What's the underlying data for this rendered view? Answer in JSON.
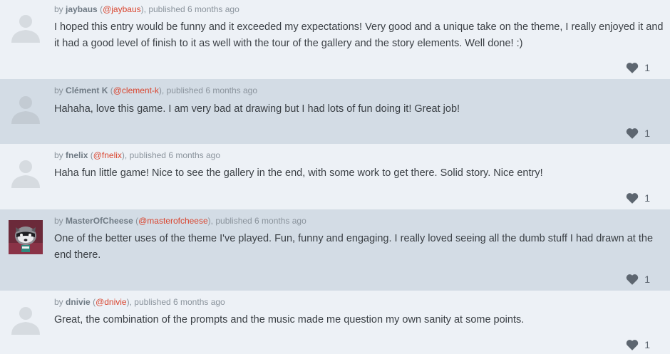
{
  "comments": [
    {
      "author": "jaybaus",
      "handle": "@jaybaus",
      "published": "published 6 months ago",
      "text": "I hoped this entry would be funny and it exceeded my expectations! Very good and a unique take on the theme, I really enjoyed it and it had a good level of finish to it as well with the tour of the gallery and the story elements. Well done! :)",
      "likes": "1",
      "avatar": "default-avatar"
    },
    {
      "author": "Clément K",
      "handle": "@clement-k",
      "published": "published 6 months ago",
      "text": "Hahaha, love this game. I am very bad at drawing but I had lots of fun doing it! Great job!",
      "likes": "1",
      "avatar": "default-avatar"
    },
    {
      "author": "fnelix",
      "handle": "@fnelix",
      "published": "published 6 months ago",
      "text": "Haha fun little game! Nice to see the gallery in the end, with some work to get there. Solid story. Nice entry!",
      "likes": "1",
      "avatar": "default-avatar"
    },
    {
      "author": "MasterOfCheese",
      "handle": "@masterofcheese",
      "published": "published 6 months ago",
      "text": "One of the better uses of the theme I've played. Fun, funny and engaging. I really loved seeing all the dumb stuff I had drawn at the end there.",
      "likes": "1",
      "avatar": "raccoon-picture"
    },
    {
      "author": "dnivie",
      "handle": "@dnivie",
      "published": "published 6 months ago",
      "text": "Great, the combination of the prompts and the music made me question my own sanity at some points.",
      "likes": "1",
      "avatar": "default-avatar"
    }
  ],
  "labels": {
    "by": "by",
    "open_paren": "(",
    "close_paren": "),"
  },
  "colors": {
    "light_row": "#edf1f6",
    "dark_row": "#d3dce5",
    "handle": "#d9452f",
    "avatar_placeholder": "#d6dbe0"
  },
  "icons": {
    "like": "heart-icon"
  }
}
